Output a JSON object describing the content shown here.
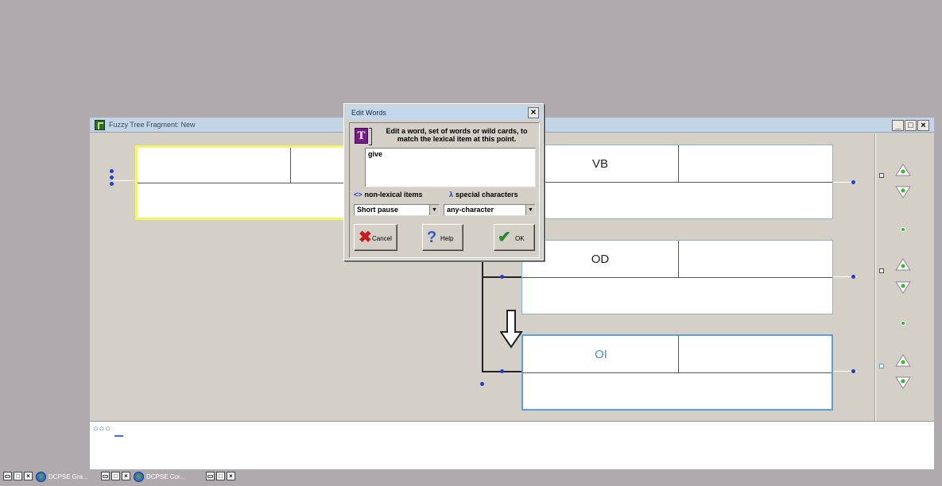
{
  "window": {
    "title": "Fuzzy Tree Fragment: New",
    "controls": [
      "_",
      "□",
      "×"
    ]
  },
  "nodes": [
    {
      "label": "",
      "id": "left-node"
    },
    {
      "label": "VB",
      "id": "vb"
    },
    {
      "label": "OD",
      "id": "od"
    },
    {
      "label": "OI",
      "id": "oi"
    }
  ],
  "status": {
    "dots": "○○○"
  },
  "dialog": {
    "title": "Edit Words",
    "close": "×",
    "instruction": "Edit a word, set of words or wild cards, to match the lexical item at this point.",
    "word_value": "give",
    "non_lexical_icon": "<>",
    "non_lexical_label": "non-lexical items",
    "special_icon": "λ",
    "special_label": "special characters",
    "combo_left": "Short pause",
    "combo_right": "any-character",
    "cancel_label": "Cancel",
    "help_label": "Help",
    "ok_label": "OK"
  },
  "taskbar": {
    "item1": "DCPSE Gra...",
    "item2": "DCPSE Cor..."
  },
  "colors": {
    "selected_yellow": "#f5f56a",
    "selected_blue": "#5aa0e0",
    "dot_blue": "#1a3fd6",
    "green_arrow": "#2cc02c"
  }
}
